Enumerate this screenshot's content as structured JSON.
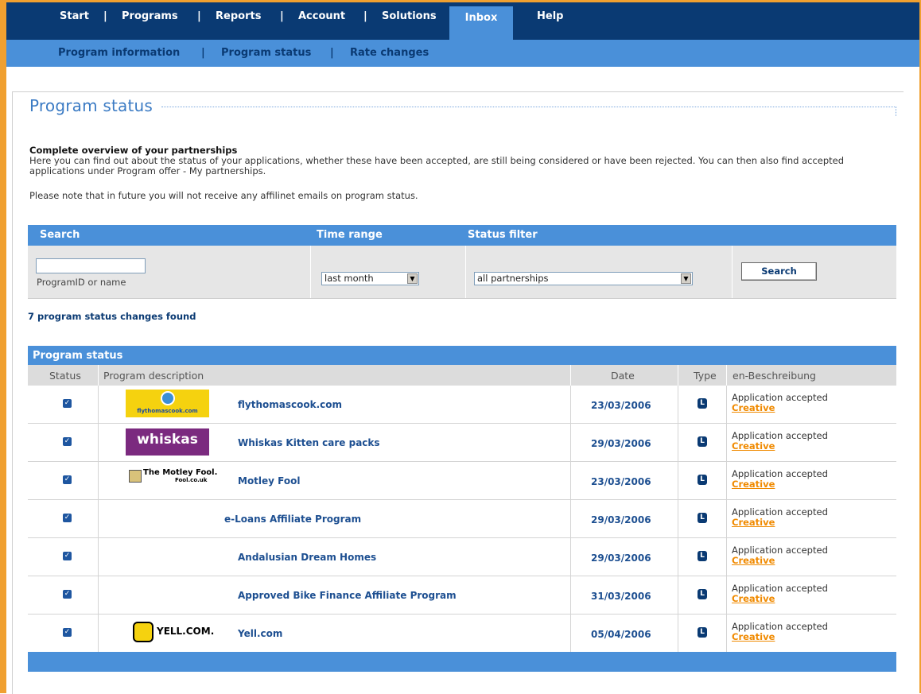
{
  "nav": {
    "items": [
      "Start",
      "Programs",
      "Reports",
      "Account",
      "Solutions"
    ],
    "active": "Inbox",
    "help": "Help"
  },
  "subnav": {
    "items": [
      "Program information",
      "Program status",
      "Rate changes"
    ]
  },
  "page": {
    "title": "Program status",
    "intro_heading": "Complete overview of your partnerships",
    "intro_text": "Here you can find out about the status of your applications, whether these have been accepted, are still being considered or have been rejected. You can then also find accepted applications under Program offer - My partnerships.",
    "intro_note": "Please note that in future you will not receive any affilinet emails on program status."
  },
  "filters": {
    "search_label": "Search",
    "time_label": "Time range",
    "status_label": "Status filter",
    "search_value": "",
    "search_hint": "ProgramID or name",
    "time_value": "last month",
    "status_value": "all partnerships",
    "button": "Search"
  },
  "results": {
    "count_text": "7 program status changes found"
  },
  "table": {
    "title": "Program status",
    "columns": [
      "Status",
      "Program description",
      "Date",
      "Type",
      "en-Beschreibung"
    ],
    "rows": [
      {
        "name": "flythomascook.com",
        "date": "23/03/2006",
        "desc": "Application accepted",
        "link": "Creative",
        "logo": "flythomascook"
      },
      {
        "name": "Whiskas Kitten care packs",
        "date": "29/03/2006",
        "desc": "Application accepted",
        "link": "Creative",
        "logo": "whiskas"
      },
      {
        "name": "Motley Fool",
        "date": "23/03/2006",
        "desc": "Application accepted",
        "link": "Creative",
        "logo": "motleyfool"
      },
      {
        "name": "e-Loans Affiliate Program",
        "date": "29/03/2006",
        "desc": "Application accepted",
        "link": "Creative",
        "logo": ""
      },
      {
        "name": "Andalusian Dream Homes",
        "date": "29/03/2006",
        "desc": "Application accepted",
        "link": "Creative",
        "logo": ""
      },
      {
        "name": "Approved Bike Finance Affiliate Program",
        "date": "31/03/2006",
        "desc": "Application accepted",
        "link": "Creative",
        "logo": ""
      },
      {
        "name": "Yell.com",
        "date": "05/04/2006",
        "desc": "Application accepted",
        "link": "Creative",
        "logo": "yell"
      }
    ]
  },
  "logos": {
    "flythomascook": "flythomascook.com",
    "whiskas": "whiskas",
    "motleyfool_1": "The Motley Fool.",
    "motleyfool_2": "Fool.co.uk",
    "yell": "YELL.COM."
  },
  "icons": {
    "status": "check-icon",
    "type": "type-icon"
  },
  "colors": {
    "nav_dark": "#0a3a73",
    "nav_light": "#4a90d9",
    "accent_orange": "#f08a00",
    "link_blue": "#1d4f91"
  }
}
